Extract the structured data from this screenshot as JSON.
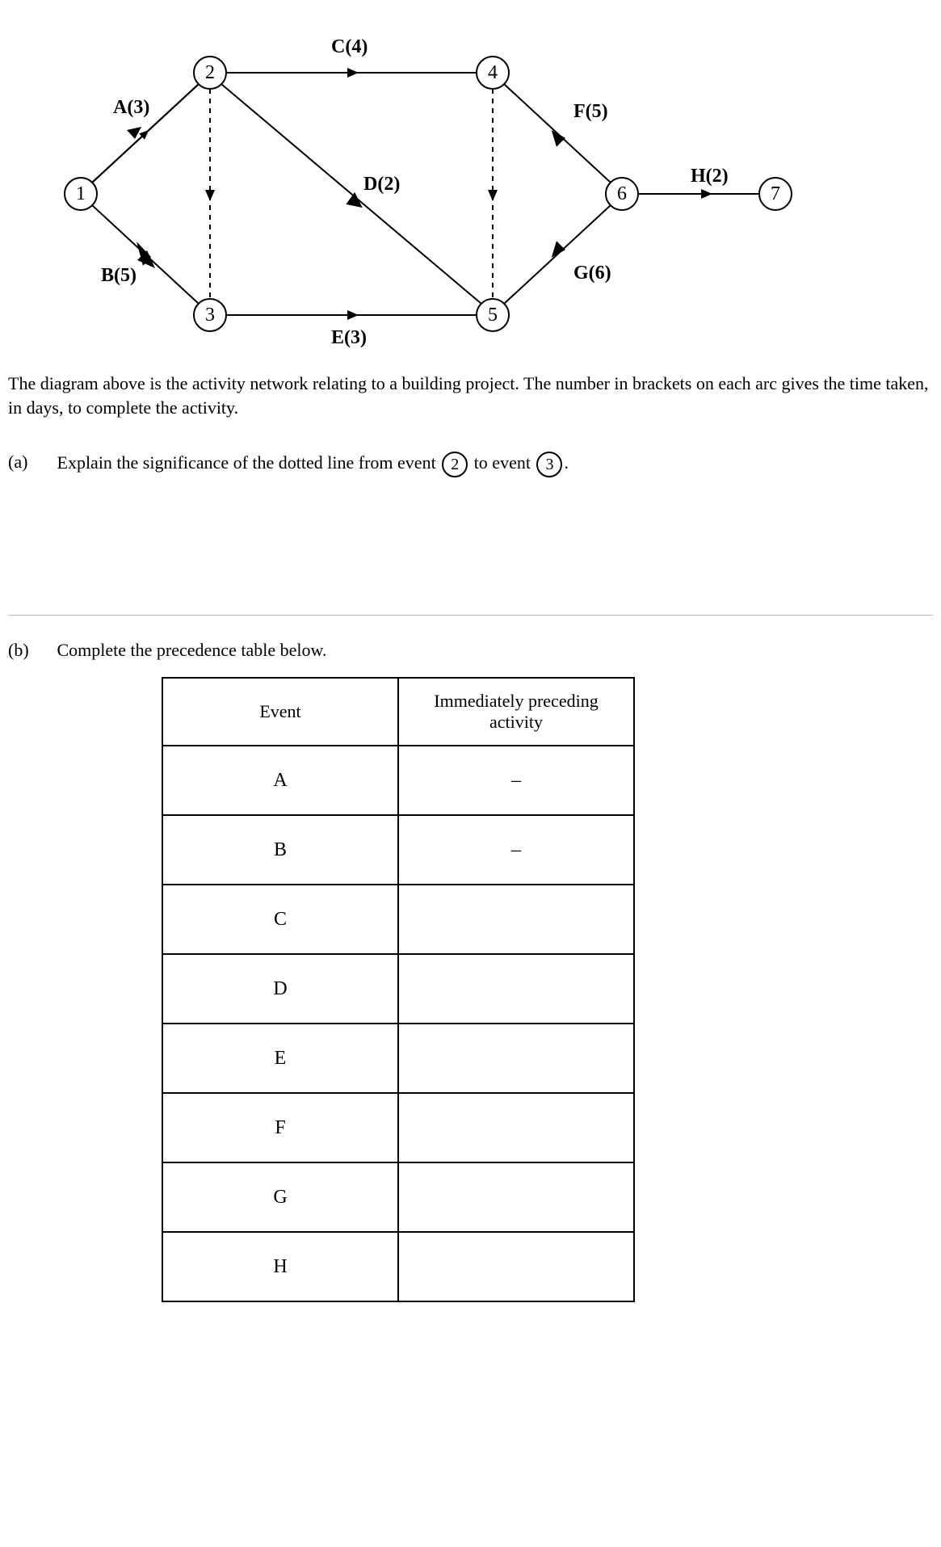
{
  "diagram": {
    "nodes": {
      "n1": "1",
      "n2": "2",
      "n3": "3",
      "n4": "4",
      "n5": "5",
      "n6": "6",
      "n7": "7"
    },
    "edges": {
      "A": "A(3)",
      "B": "B(5)",
      "C": "C(4)",
      "D": "D(2)",
      "E": "E(3)",
      "F": "F(5)",
      "G": "G(6)",
      "H": "H(2)"
    }
  },
  "description": "The diagram above is the activity network relating to a building project. The number in brackets on each arc gives the time taken, in days, to complete the activity.",
  "partA": {
    "label": "(a)",
    "text_before": "Explain the significance of the dotted line from event ",
    "circle1": "2",
    "text_mid": " to event ",
    "circle2": "3",
    "text_after": "."
  },
  "partB": {
    "label": "(b)",
    "text": "Complete the precedence table below.",
    "headers": {
      "event": "Event",
      "preceding": "Immediately preceding activity"
    },
    "rows": [
      {
        "event": "A",
        "preceding": "–"
      },
      {
        "event": "B",
        "preceding": "–"
      },
      {
        "event": "C",
        "preceding": ""
      },
      {
        "event": "D",
        "preceding": ""
      },
      {
        "event": "E",
        "preceding": ""
      },
      {
        "event": "F",
        "preceding": ""
      },
      {
        "event": "G",
        "preceding": ""
      },
      {
        "event": "H",
        "preceding": ""
      }
    ]
  },
  "chart_data": {
    "type": "network",
    "nodes": [
      1,
      2,
      3,
      4,
      5,
      6,
      7
    ],
    "edges": [
      {
        "name": "A",
        "from": 1,
        "to": 2,
        "duration": 3
      },
      {
        "name": "B",
        "from": 1,
        "to": 3,
        "duration": 5
      },
      {
        "name": "C",
        "from": 2,
        "to": 4,
        "duration": 4
      },
      {
        "name": "D",
        "from": 2,
        "to": 5,
        "duration": 2
      },
      {
        "name": "E",
        "from": 3,
        "to": 5,
        "duration": 3
      },
      {
        "name": "F",
        "from": 4,
        "to": 6,
        "duration": 5
      },
      {
        "name": "G",
        "from": 5,
        "to": 6,
        "duration": 6
      },
      {
        "name": "H",
        "from": 6,
        "to": 7,
        "duration": 2
      },
      {
        "name": "dummy23",
        "from": 2,
        "to": 3,
        "duration": 0,
        "dummy": true
      },
      {
        "name": "dummy45",
        "from": 4,
        "to": 5,
        "duration": 0,
        "dummy": true
      }
    ]
  }
}
